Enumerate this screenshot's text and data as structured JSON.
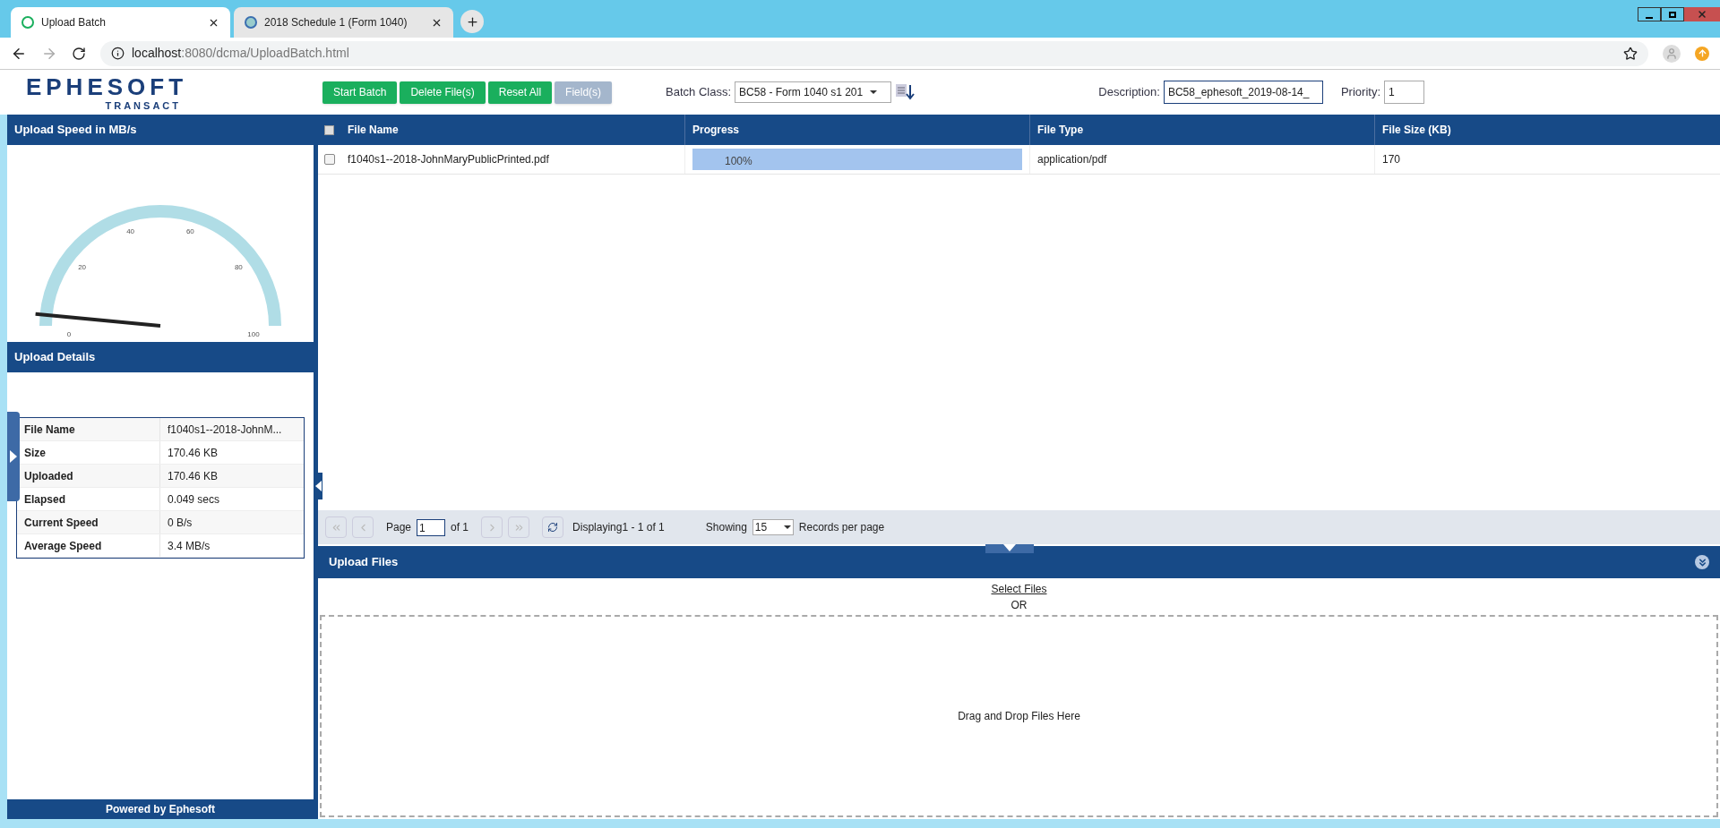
{
  "browser": {
    "tabs": [
      {
        "title": "Upload Batch",
        "selected": true
      },
      {
        "title": "2018 Schedule 1 (Form 1040)",
        "selected": false
      }
    ],
    "url_host": "localhost",
    "url_rest": ":8080/dcma/UploadBatch.html"
  },
  "logo": {
    "name": "EPHESOFT",
    "sub": "TRANSACT"
  },
  "toolbar": {
    "buttons": [
      {
        "label": "Start Batch",
        "disabled": false
      },
      {
        "label": "Delete File(s)",
        "disabled": false
      },
      {
        "label": "Reset All",
        "disabled": false
      },
      {
        "label": "Field(s)",
        "disabled": true
      }
    ],
    "batch_class": {
      "label": "Batch Class:",
      "value": "BC58 - Form 1040 s1 201"
    },
    "description": {
      "label": "Description:",
      "value": "BC58_ephesoft_2019-08-14_"
    },
    "priority": {
      "label": "Priority:",
      "value": "1"
    }
  },
  "speed_panel": {
    "title": "Upload Speed in MB/s",
    "ticks": [
      "0",
      "20",
      "40",
      "60",
      "80",
      "100"
    ],
    "level": 0.03
  },
  "details_panel": {
    "title": "Upload Details",
    "rows": [
      {
        "label": "File Name",
        "value": "f1040s1--2018-JohnM..."
      },
      {
        "label": "Size",
        "value": "170.46 KB"
      },
      {
        "label": "Uploaded",
        "value": "170.46 KB"
      },
      {
        "label": "Elapsed",
        "value": "0.049 secs"
      },
      {
        "label": "Current Speed",
        "value": "0 B/s"
      },
      {
        "label": "Average Speed",
        "value": "3.4 MB/s"
      }
    ]
  },
  "footer": "Powered by Ephesoft",
  "grid": {
    "all_checked": false,
    "columns": [
      "File Name",
      "Progress",
      "File Type",
      "File Size (KB)"
    ],
    "rows": [
      {
        "checked": false,
        "file_name": "f1040s1--2018-JohnMaryPublicPrinted.pdf",
        "progress": {
          "level": 1,
          "text": "100%"
        },
        "file_type": "application/pdf",
        "file_size": "170"
      }
    ]
  },
  "pager": {
    "page_label": "Page",
    "page": "1",
    "of": "of 1",
    "displaying": "Displaying1 - 1 of 1",
    "showing": "Showing",
    "per_page": "15",
    "records": "Records per page"
  },
  "upload": {
    "title": "Upload Files",
    "select": "Select Files",
    "or": "OR",
    "drop": "Drag and Drop Files Here"
  }
}
